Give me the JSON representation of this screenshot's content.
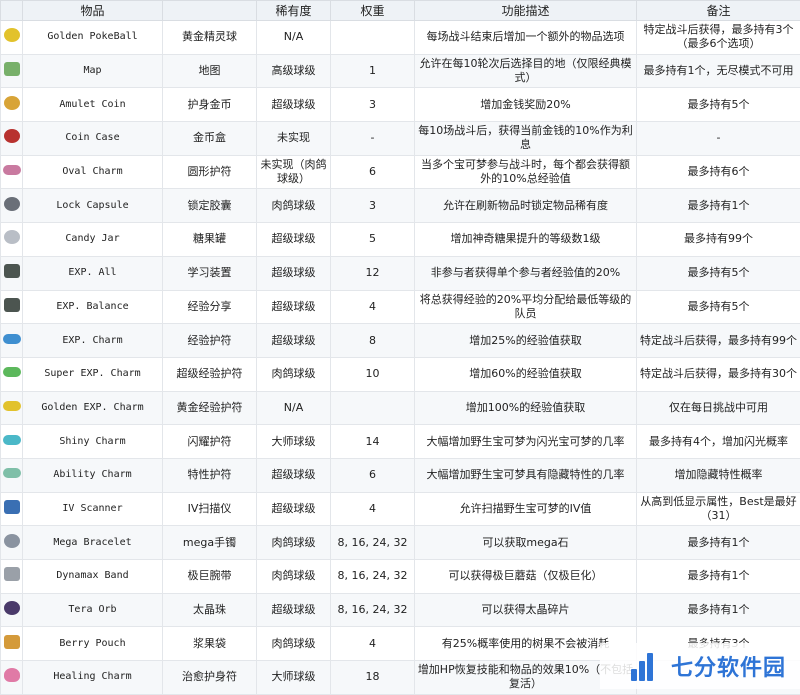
{
  "table": {
    "headers": [
      "",
      "物品",
      "",
      "稀有度",
      "权重",
      "功能描述",
      "备注"
    ],
    "rows": [
      {
        "icon": "golden-pokeball-icon",
        "color": "#e2c22c",
        "shape": "round",
        "name_en": "Golden PokeBall",
        "name_cn": "黄金精灵球",
        "rarity": "N/A",
        "weight": "",
        "desc": "每场战斗结束后增加一个额外的物品选项",
        "note": "特定战斗后获得，最多持有3个（最多6个选项）"
      },
      {
        "icon": "map-icon",
        "color": "#78b06a",
        "shape": "square",
        "name_en": "Map",
        "name_cn": "地图",
        "rarity": "高级球级",
        "weight": "1",
        "desc": "允许在每10轮次后选择目的地（仅限经典模式）",
        "note": "最多持有1个，无尽模式不可用"
      },
      {
        "icon": "amulet-coin-icon",
        "color": "#d8a437",
        "shape": "round",
        "name_en": "Amulet Coin",
        "name_cn": "护身金币",
        "rarity": "超级球级",
        "weight": "3",
        "desc": "增加金钱奖励20%",
        "note": "最多持有5个"
      },
      {
        "icon": "coin-case-icon",
        "color": "#b8322f",
        "shape": "round",
        "name_en": "Coin Case",
        "name_cn": "金币盒",
        "rarity": "未实现",
        "weight": "-",
        "desc": "每10场战斗后，获得当前金钱的10%作为利息",
        "note": "-"
      },
      {
        "icon": "oval-charm-icon",
        "color": "#c97aa0",
        "shape": "pill",
        "name_en": "Oval Charm",
        "name_cn": "圆形护符",
        "rarity": "未实现（肉鸽球级）",
        "weight": "6",
        "desc": "当多个宝可梦参与战斗时，每个都会获得额外的10%总经验值",
        "note": "最多持有6个"
      },
      {
        "icon": "lock-capsule-icon",
        "color": "#6a6f78",
        "shape": "round",
        "name_en": "Lock Capsule",
        "name_cn": "锁定胶囊",
        "rarity": "肉鸽球级",
        "weight": "3",
        "desc": "允许在刷新物品时锁定物品稀有度",
        "note": "最多持有1个"
      },
      {
        "icon": "candy-jar-icon",
        "color": "#b9bec6",
        "shape": "round",
        "name_en": "Candy Jar",
        "name_cn": "糖果罐",
        "rarity": "超级球级",
        "weight": "5",
        "desc": "增加神奇糖果提升的等级数1级",
        "note": "最多持有99个"
      },
      {
        "icon": "exp-all-icon",
        "color": "#4c5550",
        "shape": "square",
        "name_en": "EXP. All",
        "name_cn": "学习装置",
        "rarity": "超级球级",
        "weight": "12",
        "desc": "非参与者获得单个参与者经验值的20%",
        "note": "最多持有5个"
      },
      {
        "icon": "exp-balance-icon",
        "color": "#4c5550",
        "shape": "square",
        "name_en": "EXP. Balance",
        "name_cn": "经验分享",
        "rarity": "超级球级",
        "weight": "4",
        "desc": "将总获得经验的20%平均分配给最低等级的队员",
        "note": "最多持有5个"
      },
      {
        "icon": "exp-charm-icon",
        "color": "#3f8fd0",
        "shape": "pill",
        "name_en": "EXP. Charm",
        "name_cn": "经验护符",
        "rarity": "超级球级",
        "weight": "8",
        "desc": "增加25%的经验值获取",
        "note": "特定战斗后获得，最多持有99个"
      },
      {
        "icon": "super-exp-charm-icon",
        "color": "#5cb85c",
        "shape": "pill",
        "name_en": "Super EXP. Charm",
        "name_cn": "超级经验护符",
        "rarity": "肉鸽球级",
        "weight": "10",
        "desc": "增加60%的经验值获取",
        "note": "特定战斗后获得，最多持有30个"
      },
      {
        "icon": "golden-exp-charm-icon",
        "color": "#e2c22c",
        "shape": "pill",
        "name_en": "Golden EXP. Charm",
        "name_cn": "黄金经验护符",
        "rarity": "N/A",
        "weight": "",
        "desc": "增加100%的经验值获取",
        "note": "仅在每日挑战中可用"
      },
      {
        "icon": "shiny-charm-icon",
        "color": "#4bb8c8",
        "shape": "pill",
        "name_en": "Shiny Charm",
        "name_cn": "闪耀护符",
        "rarity": "大师球级",
        "weight": "14",
        "desc": "大幅增加野生宝可梦为闪光宝可梦的几率",
        "note": "最多持有4个，增加闪光概率"
      },
      {
        "icon": "ability-charm-icon",
        "color": "#7fbfa8",
        "shape": "pill",
        "name_en": "Ability Charm",
        "name_cn": "特性护符",
        "rarity": "超级球级",
        "weight": "6",
        "desc": "大幅增加野生宝可梦具有隐藏特性的几率",
        "note": "增加隐藏特性概率"
      },
      {
        "icon": "iv-scanner-icon",
        "color": "#3a6fb3",
        "shape": "square",
        "name_en": "IV Scanner",
        "name_cn": "IV扫描仪",
        "rarity": "超级球级",
        "weight": "4",
        "desc": "允许扫描野生宝可梦的IV值",
        "note": "从高到低显示属性，Best是最好（31）"
      },
      {
        "icon": "mega-bracelet-icon",
        "color": "#8a93a0",
        "shape": "round",
        "name_en": "Mega Bracelet",
        "name_cn": "mega手镯",
        "rarity": "肉鸽球级",
        "weight": "8, 16, 24, 32",
        "desc": "可以获取mega石",
        "note": "最多持有1个"
      },
      {
        "icon": "dynamax-band-icon",
        "color": "#9aa0a8",
        "shape": "square",
        "name_en": "Dynamax Band",
        "name_cn": "极巨腕带",
        "rarity": "肉鸽球级",
        "weight": "8, 16, 24, 32",
        "desc": "可以获得极巨蘑菇（仅极巨化）",
        "note": "最多持有1个"
      },
      {
        "icon": "tera-orb-icon",
        "color": "#4a3a6a",
        "shape": "round",
        "name_en": "Tera Orb",
        "name_cn": "太晶珠",
        "rarity": "超级球级",
        "weight": "8, 16, 24, 32",
        "desc": "可以获得太晶碎片",
        "note": "最多持有1个"
      },
      {
        "icon": "berry-pouch-icon",
        "color": "#d49a3a",
        "shape": "square",
        "name_en": "Berry Pouch",
        "name_cn": "浆果袋",
        "rarity": "肉鸽球级",
        "weight": "4",
        "desc": "有25%概率使用的树果不会被消耗",
        "note": "最多持有3个"
      },
      {
        "icon": "healing-charm-icon",
        "color": "#e07aa6",
        "shape": "heart",
        "name_en": "Healing Charm",
        "name_cn": "治愈护身符",
        "rarity": "大师球级",
        "weight": "18",
        "desc": "增加HP恢复技能和物品的效果10%（不包括复活）",
        "note": ""
      }
    ]
  },
  "watermark": {
    "text": "七分软件园",
    "color": "#2e74d6"
  }
}
